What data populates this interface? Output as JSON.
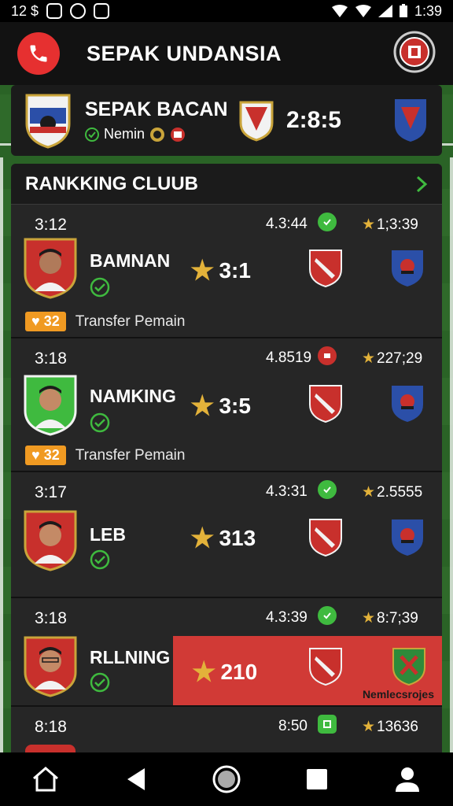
{
  "status_bar": {
    "left_text": "12 $",
    "time": "1:39"
  },
  "app_bar": {
    "title": "SEPAK UNDANSIA"
  },
  "match": {
    "title": "SEPAK BACAN",
    "subtitle": "Nemin",
    "score": "2:8:5"
  },
  "ranking": {
    "title": "RANKKING CLUUB",
    "rows": [
      {
        "rank": "3:12",
        "time": "4.3:44",
        "status": "ok",
        "rating": "1;3:39",
        "name": "BAMNAN",
        "score": "3:1",
        "transfer_count": "32",
        "transfer_label": "Transfer Pemain"
      },
      {
        "rank": "3:18",
        "time": "4.8519",
        "status": "alert",
        "rating": "227;29",
        "name": "NAMKING",
        "score": "3:5",
        "transfer_count": "32",
        "transfer_label": "Transfer Pemain"
      },
      {
        "rank": "3:17",
        "time": "4.3:31",
        "status": "ok",
        "rating": "2.5555",
        "name": "LEB",
        "score": "313"
      },
      {
        "rank": "3:18",
        "time": "4.3:39",
        "status": "ok",
        "rating": "8:7;39",
        "name": "RLLNING",
        "score": "210",
        "highlight_caption": "Nemlecsrojes"
      },
      {
        "rank": "8:18",
        "time": "8:50",
        "status": "ok",
        "rating": "13636"
      }
    ]
  },
  "colors": {
    "accent_red": "#e63030",
    "star": "#e3b23a",
    "ok_green": "#3fba3f",
    "badge_orange": "#f09a22"
  }
}
